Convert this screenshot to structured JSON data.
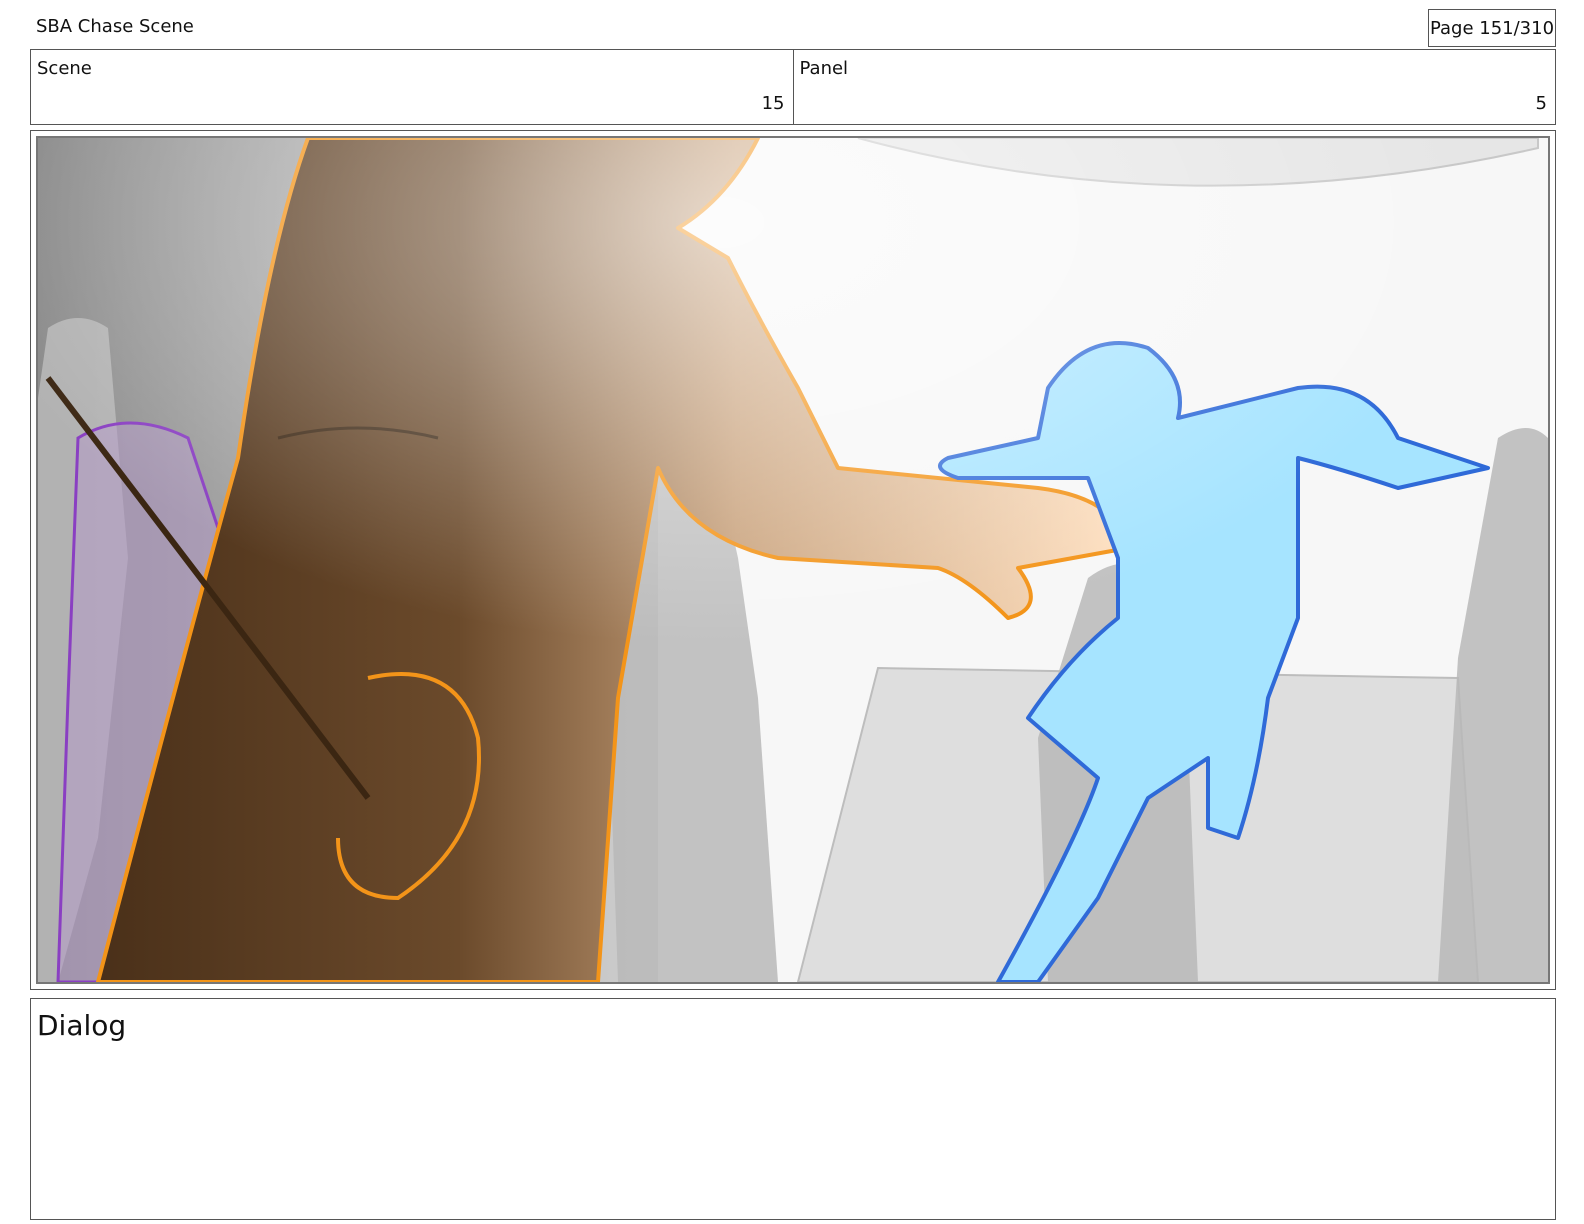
{
  "document": {
    "title": "SBA Chase Scene",
    "page": "Page 151/310"
  },
  "header": {
    "scene_label": "Scene",
    "scene_value": "15",
    "panel_label": "Panel",
    "panel_value": "5"
  },
  "dialog": {
    "label": "Dialog",
    "text": ""
  },
  "panel": {
    "colors": {
      "foreground_figure_dark": "#5a3d22",
      "foreground_figure_light": "#ffd8b0",
      "foreground_outline": "#f39419",
      "running_figure_fill": "#a6e4ff",
      "running_figure_outline": "#2f6ad8",
      "purple_figure": "#8a3fc2",
      "background_gray": "#9b9b9b"
    }
  }
}
